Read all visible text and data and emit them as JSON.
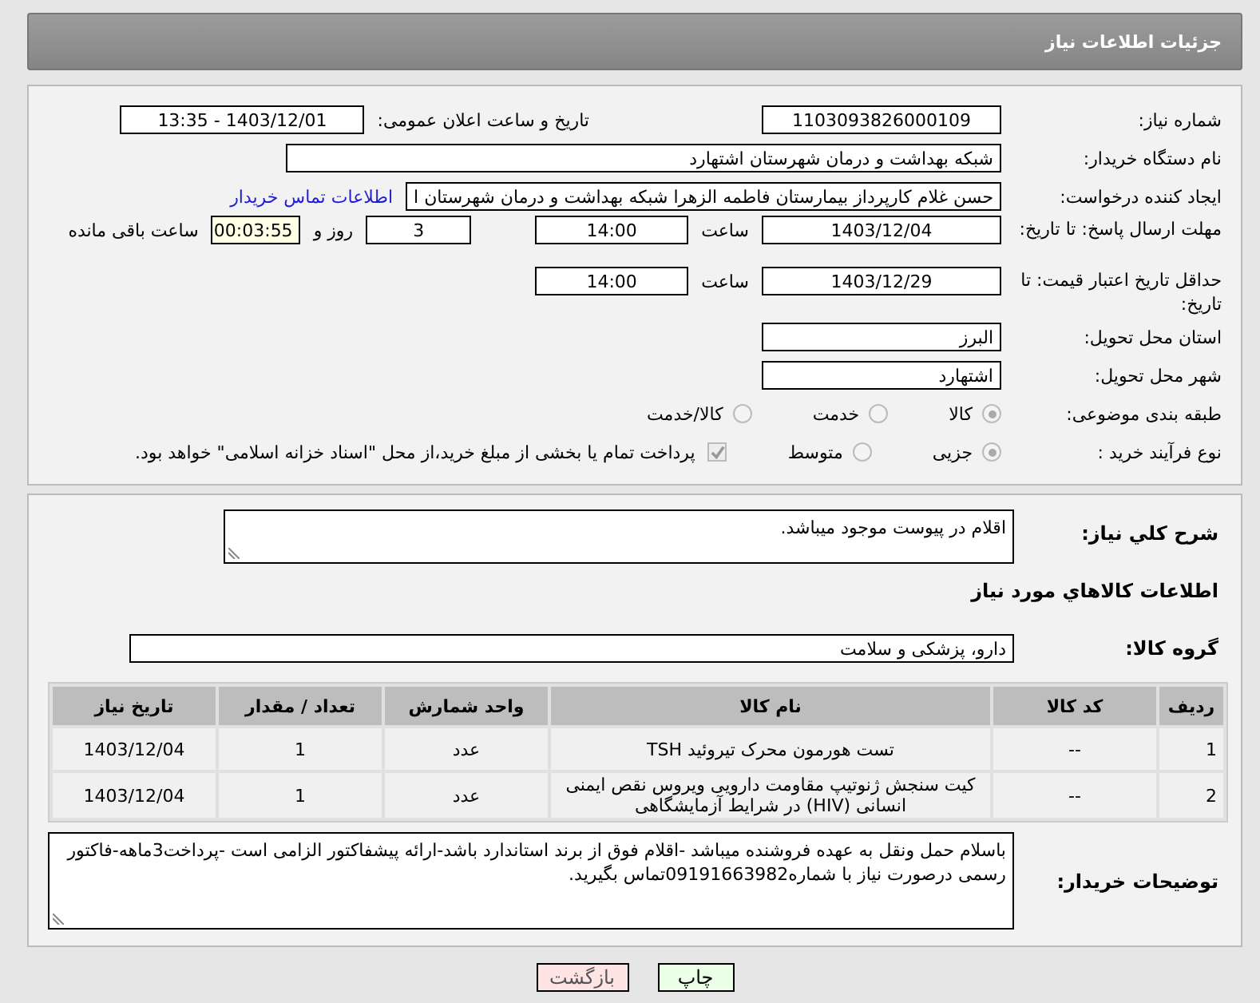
{
  "header": {
    "title": "جزئیات اطلاعات نیاز"
  },
  "details": {
    "need_number": {
      "label": "شماره نیاز:",
      "value": "1103093826000109"
    },
    "announce": {
      "label": "تاریخ و ساعت اعلان عمومی:",
      "value": "1403/12/01 - 13:35"
    },
    "buyer": {
      "label": "نام دستگاه خریدار:",
      "value": "شبکه بهداشت و درمان شهرستان اشتهارد"
    },
    "requester": {
      "label": "ایجاد کننده درخواست:",
      "value": "حسن غلام کارپرداز بیمارستان فاطمه الزهرا شبکه بهداشت و درمان شهرستان ا",
      "link": "اطلاعات تماس خریدار"
    },
    "deadline": {
      "label": "مهلت ارسال پاسخ: تا تاریخ:",
      "date": "1403/12/04",
      "time_label": "ساعت",
      "time": "14:00",
      "days": "3",
      "days_label": "روز و",
      "remaining": "00:03:55",
      "remaining_label": "ساعت باقی مانده"
    },
    "validity": {
      "label": "حداقل تاریخ اعتبار قیمت: تا تاریخ:",
      "date": "1403/12/29",
      "time_label": "ساعت",
      "time": "14:00"
    },
    "province": {
      "label": "استان محل تحویل:",
      "value": "البرز"
    },
    "city": {
      "label": "شهر محل تحویل:",
      "value": "اشتهارد"
    },
    "category": {
      "label": "طبقه بندی موضوعی:",
      "options": [
        {
          "label": "کالا",
          "selected": true
        },
        {
          "label": "خدمت",
          "selected": false
        },
        {
          "label": "کالا/خدمت",
          "selected": false
        }
      ]
    },
    "process": {
      "label": "نوع فرآیند خرید :",
      "options": [
        {
          "label": "جزیی",
          "selected": true
        },
        {
          "label": "متوسط",
          "selected": false
        }
      ],
      "treasury": {
        "checked": true,
        "text": "پرداخت تمام یا بخشی از مبلغ خرید،از محل \"اسناد خزانه اسلامی\" خواهد بود."
      }
    }
  },
  "items": {
    "description": {
      "label": "شرح کلي نياز:",
      "value": "اقلام در پیوست موجود میباشد."
    },
    "section_title": "اطلاعات کالاهاي مورد نياز",
    "group": {
      "label": "گروه کالا:",
      "value": "دارو، پزشکی و سلامت"
    },
    "table": {
      "columns": [
        "ردیف",
        "کد کالا",
        "نام کالا",
        "واحد شمارش",
        "تعداد / مقدار",
        "تاریخ نیاز"
      ],
      "rows": [
        [
          "1",
          "--",
          "تست هورمون محرک تیروئید TSH",
          "عدد",
          "1",
          "1403/12/04"
        ],
        [
          "2",
          "--",
          "کیت سنجش ژنوتیپ مقاومت دارویی ویروس نقص ایمنی انسانی (HIV) در شرایط آزمایشگاهی",
          "عدد",
          "1",
          "1403/12/04"
        ]
      ]
    },
    "buyer_notes": {
      "label": "توضیحات خریدار:",
      "value": "باسلام حمل ونقل به عهده فروشنده میباشد -اقلام فوق از برند استاندارد باشد-ارائه پیشفاکتور الزامی است -پرداخت3ماهه-فاکتور رسمی درصورت نیاز با شماره09191663982تماس بگیرید."
    }
  },
  "buttons": [
    {
      "label": "چاپ",
      "kind": "print"
    },
    {
      "label": "بازگشت",
      "kind": "back"
    }
  ]
}
